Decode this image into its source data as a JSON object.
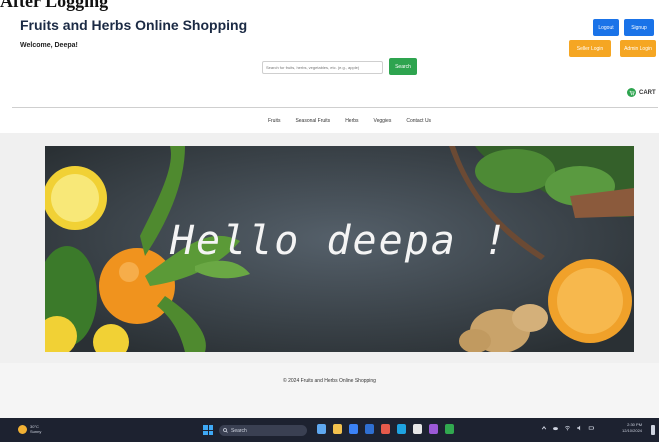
{
  "caption": "After Logging",
  "header": {
    "title": "Fruits and Herbs Online Shopping",
    "welcome": "Welcome, Deepa!",
    "buttons": {
      "logout": "Logout",
      "signup": "Signup",
      "seller": "Seller Login",
      "admin": "Admin Login"
    },
    "colors": {
      "primary": "#1a73e8",
      "warning": "#f5a623",
      "success": "#2ea44f"
    }
  },
  "search": {
    "placeholder": "Search for fruits, herbs, vegetables, etc. (e.g., apple)",
    "button": "Search"
  },
  "cart": {
    "label": "CART",
    "icon": "cart-icon"
  },
  "nav": {
    "items": [
      "Fruits",
      "Seasonal Fruits",
      "Herbs",
      "Veggies",
      "Contact Us"
    ]
  },
  "banner": {
    "greeting": "Hello deepa !"
  },
  "footer": {
    "copyright": "© 2024 Fruits and Herbs Online Shopping"
  },
  "taskbar": {
    "weather_temp": "30°C",
    "weather_desc": "Sunny",
    "search_label": "Search",
    "time": "2:30 PM",
    "date": "12/10/2024"
  }
}
